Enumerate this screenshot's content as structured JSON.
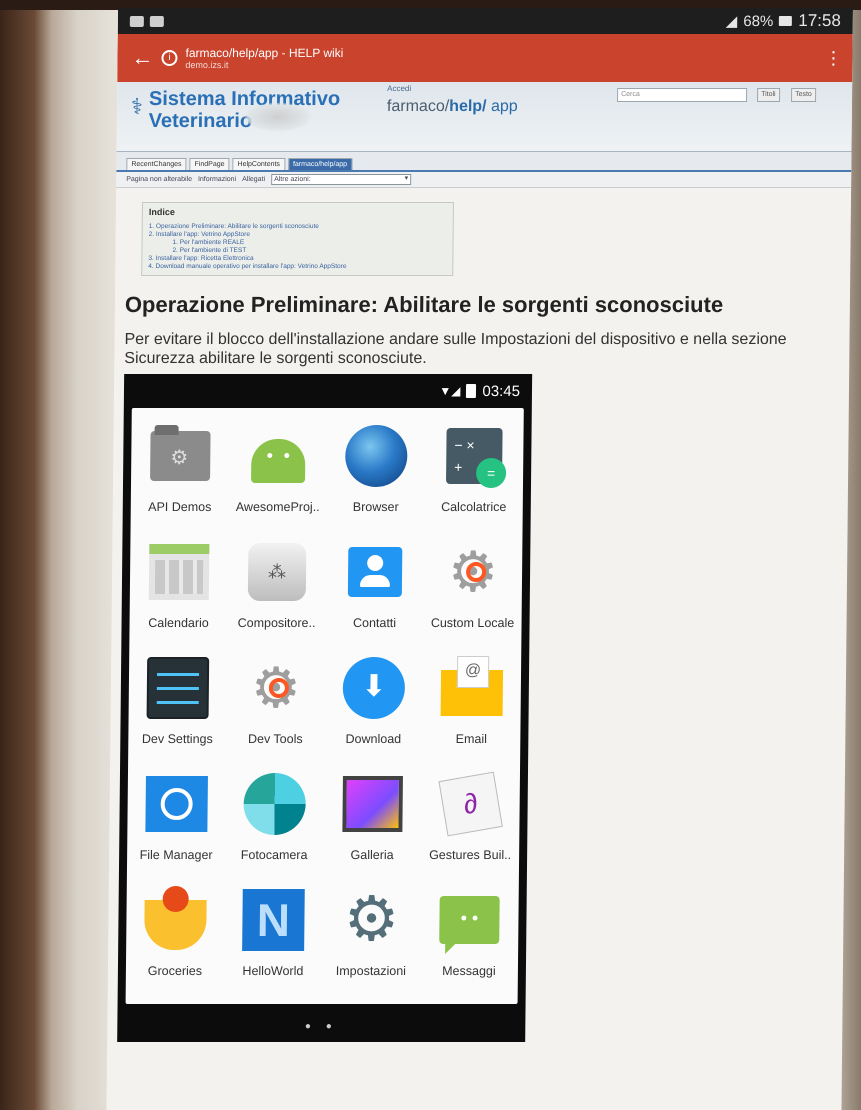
{
  "device": {
    "battery": "68%",
    "time": "17:58"
  },
  "browser": {
    "url_title": "farmaco/help/app - HELP wiki",
    "domain": "demo.izs.it"
  },
  "wiki": {
    "logo_line1": "Sistema Informativo",
    "logo_line2": "Veterinario",
    "accedi": "Accedi",
    "path_seg1": "farmaco/",
    "path_seg2": "help/",
    "path_seg3": "app",
    "search_placeholder": "Cerca",
    "btn_titoli": "Titoli",
    "btn_testo": "Testo",
    "tabs": [
      "RecentChanges",
      "FindPage",
      "HelpContents",
      "farmaco/help/app"
    ],
    "actions": [
      "Pagina non alterabile",
      "Informazioni",
      "Allegati"
    ],
    "actions_select": "Altre azioni:"
  },
  "toc": {
    "title": "Indice",
    "items": [
      "1. Operazione Preliminare: Abilitare le sorgenti sconosciute",
      "2. Installare l'app: Vetrino AppStore",
      "1. Per l'ambiente REALE",
      "2. Per l'ambiente di TEST",
      "3. Installare l'app: Ricetta Elettronica",
      "4. Download manuale operativo per installare l'app: Vetrino AppStore"
    ]
  },
  "section": {
    "heading": "Operazione Preliminare: Abilitare le sorgenti sconosciute",
    "text": "Per evitare il blocco dell'installazione andare sulle Impostazioni del dispositivo e nella sezione Sicurezza abilitare le sorgenti sconosciute."
  },
  "phone": {
    "time": "03:45",
    "apps": [
      {
        "label": "API Demos",
        "icon": "folder-gear-icon"
      },
      {
        "label": "AwesomeProj..",
        "icon": "android-icon"
      },
      {
        "label": "Browser",
        "icon": "globe-icon"
      },
      {
        "label": "Calcolatrice",
        "icon": "calculator-icon"
      },
      {
        "label": "Calendario",
        "icon": "calendar-icon"
      },
      {
        "label": "Compositore..",
        "icon": "speaker-icon"
      },
      {
        "label": "Contatti",
        "icon": "contact-icon"
      },
      {
        "label": "Custom Locale",
        "icon": "gear-icon"
      },
      {
        "label": "Dev Settings",
        "icon": "sliders-icon"
      },
      {
        "label": "Dev Tools",
        "icon": "gear-icon"
      },
      {
        "label": "Download",
        "icon": "download-icon"
      },
      {
        "label": "Email",
        "icon": "email-icon"
      },
      {
        "label": "File Manager",
        "icon": "circle-icon"
      },
      {
        "label": "Fotocamera",
        "icon": "shutter-icon"
      },
      {
        "label": "Galleria",
        "icon": "gallery-icon"
      },
      {
        "label": "Gestures Buil..",
        "icon": "gesture-icon"
      },
      {
        "label": "Groceries",
        "icon": "fruit-icon"
      },
      {
        "label": "HelloWorld",
        "icon": "n-icon"
      },
      {
        "label": "Impostazioni",
        "icon": "settings-icon"
      },
      {
        "label": "Messaggi",
        "icon": "message-icon"
      }
    ]
  }
}
